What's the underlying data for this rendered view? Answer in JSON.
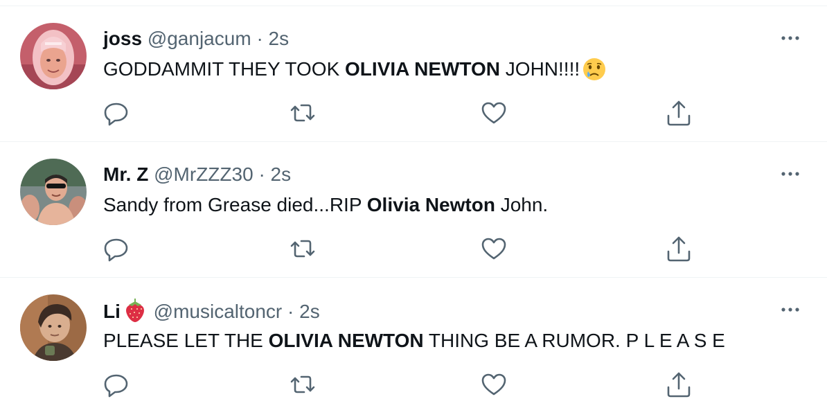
{
  "tweets": [
    {
      "name": "joss",
      "handle": "@ganjacum",
      "dot": "·",
      "time": "2s",
      "text_before": "GODDAMMIT THEY TOOK ",
      "text_bold": "OLIVIA NEWTON",
      "text_after": " JOHN!!!!",
      "trailing_emoji": "crying-face",
      "avatar_colors": {
        "bg": "#c9707a",
        "hair": "#f2b8c0",
        "face": "#e9a08f"
      }
    },
    {
      "name": "Mr. Z",
      "handle": "@MrZZZ30",
      "dot": "·",
      "time": "2s",
      "text_before": "Sandy from Grease died...RIP ",
      "text_bold": "Olivia Newton",
      "text_after": " John.",
      "avatar_colors": {
        "bg": "#6f7d83",
        "skin": "#e0a78f",
        "hair": "#2c2a28"
      }
    },
    {
      "name": "Li",
      "name_emoji": "strawberry",
      "handle": "@musicaltoncr",
      "dot": "·",
      "time": "2s",
      "text_before": "PLEASE LET THE ",
      "text_bold": "OLIVIA NEWTON",
      "text_after": " THING BE A RUMOR. P L E A S E",
      "avatar_colors": {
        "bg": "#8e5b3a",
        "skin": "#d8ab8c",
        "hair": "#3a2a22"
      }
    }
  ],
  "icons": {
    "reply": "reply-icon",
    "retweet": "retweet-icon",
    "like": "heart-icon",
    "share": "share-icon",
    "more": "more-icon"
  },
  "colors": {
    "text": "#0f1419",
    "secondary": "#536471",
    "divider": "#eff3f4"
  }
}
